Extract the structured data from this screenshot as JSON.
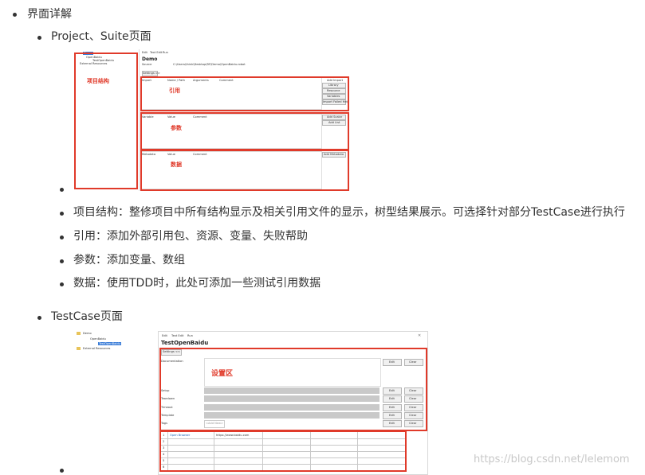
{
  "section_title": "界面详解",
  "project_suite": {
    "heading": "Project、Suite页面",
    "screenshot": {
      "tabs": [
        "Edit",
        "Text Edit",
        "Run"
      ],
      "tree": [
        "Demo",
        "OpenBaidu",
        "TestOpenBaidu",
        "External Resources"
      ],
      "title": "Demo",
      "source_label": "Source",
      "source_path": "C:\\Users\\think\\Desktop\\RF\\Demo\\OpenBaidu.robot",
      "settings_button": "Settings >>",
      "import_headers": [
        "Import",
        "Name / Path",
        "Arguments",
        "Comment"
      ],
      "import_buttons": [
        "Add Import",
        "Library",
        "Resource",
        "Variables",
        "Import Failed Help"
      ],
      "variable_headers": [
        "Variable",
        "Value",
        "Comment"
      ],
      "variable_buttons": [
        "Add Scalar",
        "Add List"
      ],
      "metadata_headers": [
        "Metadata",
        "Value",
        "Comment"
      ],
      "metadata_buttons": [
        "Add Metadata"
      ],
      "labels": {
        "structure": "项目结构",
        "reference": "引用",
        "params": "参数",
        "data": "数据"
      }
    },
    "bullets": [
      "项目结构：整修项目中所有结构显示及相关引用文件的显示，树型结果展示。可选择针对部分TestCase进行执行",
      "引用：添加外部引用包、资源、变量、失败帮助",
      "参数：添加变量、数组",
      "数据：使用TDD时，此处可添加一些测试引用数据"
    ]
  },
  "testcase": {
    "heading": "TestCase页面",
    "tree": [
      "Demo",
      "OpenBaidu",
      "TestOpenBaidu",
      "External Resources"
    ],
    "screenshot": {
      "tabs": [
        "Edit",
        "Text Edit",
        "Run"
      ],
      "title": "TestOpenBaidu",
      "settings_button": "Settings <<",
      "fields": [
        "Documentation",
        "Setup",
        "Teardown",
        "Timeout",
        "Template",
        "Tags"
      ],
      "edit_label": "Edit",
      "clear_label": "Clear",
      "tags_placeholder": "<Add New>",
      "settings_label": "设置区",
      "rows": [
        {
          "n": "1",
          "kw": "Open Browser",
          "arg": "https://www.baidu.com"
        },
        {
          "n": "2",
          "kw": "",
          "arg": ""
        },
        {
          "n": "3",
          "kw": "",
          "arg": ""
        },
        {
          "n": "4",
          "kw": "",
          "arg": ""
        },
        {
          "n": "5",
          "kw": "",
          "arg": ""
        },
        {
          "n": "6",
          "kw": "",
          "arg": ""
        }
      ]
    }
  },
  "watermark": "https://blog.csdn.net/lelemom"
}
